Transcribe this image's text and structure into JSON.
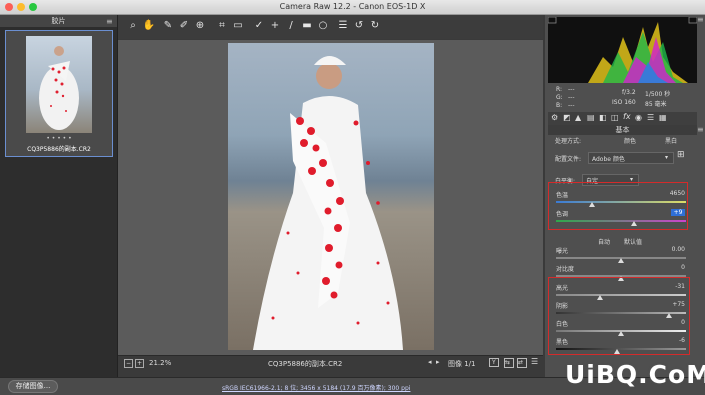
{
  "window": {
    "title": "Camera Raw 12.2  -  Canon EOS-1D X"
  },
  "filmstrip": {
    "header": "胶片",
    "thumbnail_caption": "CQ3P5886的副本.CR2",
    "rating_dots": "• • • • •"
  },
  "toolbar": {
    "icons": [
      "zoom-icon",
      "hand-icon",
      "white-balance-icon",
      "color-sampler-icon",
      "target-adjust-icon",
      "crop-icon",
      "straighten-icon",
      "spot-removal-icon",
      "red-eye-icon",
      "brush-icon",
      "graduated-filter-icon",
      "radial-filter-icon",
      "list-icon",
      "rotate-left-icon",
      "rotate-right-icon"
    ]
  },
  "canvas": {
    "zoom": "21.2%",
    "filename": "CQ3P5886的副本.CR2",
    "image_counter": "图像 1/1"
  },
  "footer": {
    "save_button": "存储图像...",
    "info_link": "sRGB IEC61966-2.1; 8 位; 3456 x 5184 (17.9 百万像素); 300 ppi"
  },
  "histogram": {
    "r_label": "R:",
    "g_label": "G:",
    "b_label": "B:",
    "r_value": "---",
    "g_value": "---",
    "b_value": "---",
    "aperture": "f/3.2",
    "shutter": "1/500 秒",
    "iso": "ISO 160",
    "focal": "85 毫米"
  },
  "panel": {
    "tab_title": "基本",
    "treatment_label": "处理方式:",
    "treatment_color": "颜色",
    "treatment_bw": "黑白",
    "profile_label": "配置文件:",
    "profile_value": "Adobe 颜色",
    "wb_label": "白平衡:",
    "wb_value": "自定",
    "auto_label": "自动",
    "default_label": "默认值",
    "sliders_top": [
      {
        "label": "色温",
        "value": "4650",
        "pos": 0.28
      },
      {
        "label": "色调",
        "value": "+9",
        "pos": 0.6
      }
    ],
    "sliders_mid": [
      {
        "label": "曝光",
        "value": "0.00",
        "pos": 0.5
      },
      {
        "label": "对比度",
        "value": "0",
        "pos": 0.5
      }
    ],
    "sliders_bottom": [
      {
        "label": "高光",
        "value": "-31",
        "pos": 0.34
      },
      {
        "label": "阴影",
        "value": "+75",
        "pos": 0.87
      },
      {
        "label": "白色",
        "value": "0",
        "pos": 0.5
      },
      {
        "label": "黑色",
        "value": "-6",
        "pos": 0.47
      }
    ]
  },
  "watermark": {
    "text": "UiBQ.CoM"
  }
}
